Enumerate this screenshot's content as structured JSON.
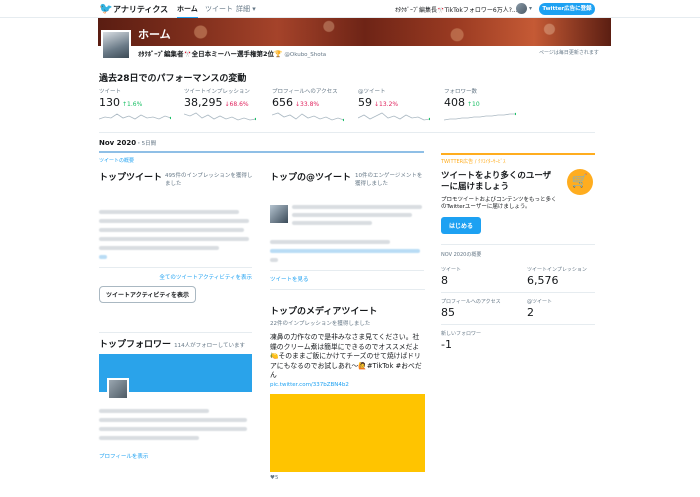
{
  "nav": {
    "brand": "アナリティクス",
    "tabs": [
      {
        "label": "ホーム",
        "active": true
      },
      {
        "label": "ツイート",
        "active": false
      },
      {
        "label": "詳細",
        "active": false
      }
    ],
    "account_label": "ｵﾀｸﾎﾞｰﾌﾞ編集長🎌TikTokフォロワー6万人?...",
    "ads_button": "Twitter広告に登録"
  },
  "banner": {
    "title": "ホーム"
  },
  "profile": {
    "name": "ｵﾀｸﾎﾞｰﾌﾞ編集者🎌全日本ミーハー選手権第2位🏆",
    "handle": "@Okubo_Shota"
  },
  "update_note": "ページは毎日更新されます",
  "performance": {
    "title": "過去28日でのパフォーマンスの変動",
    "metrics": [
      {
        "label": "ツイート",
        "value": "130",
        "change": "1.6%",
        "dir": "up"
      },
      {
        "label": "ツイートインプレッション",
        "value": "38,295",
        "change": "68.6%",
        "dir": "down"
      },
      {
        "label": "プロフィールへのアクセス",
        "value": "656",
        "change": "33.8%",
        "dir": "down"
      },
      {
        "label": "@ツイート",
        "value": "59",
        "change": "13.2%",
        "dir": "down"
      },
      {
        "label": "フォロワー数",
        "value": "408",
        "change": "10",
        "dir": "up"
      }
    ]
  },
  "period": {
    "label": "Nov 2020",
    "days": "・5日間"
  },
  "summary_label": "ツイートの概要",
  "top_tweet": {
    "title": "トップツイート",
    "sub": "495件のインプレッションを獲得しました",
    "all_link": "全てのツイートアクティビティを表示",
    "button": "ツイートアクティビティを表示"
  },
  "top_mention": {
    "title": "トップの@ツイート",
    "sub": "10件のエンゲージメントを獲得しました",
    "link": "ツイートを見る"
  },
  "top_media": {
    "title": "トップのメディアツイート",
    "sub": "22件のインプレッションを獲得しました",
    "text": "凍鼻の力作なので是非みなさま見てください。社蝶のクリーム煮は簡単にできるのでオススメだよ🍋そのままご飯にかけてチーズのせて焼けばドリアにもなるのでお試しあれ〜🙋#TikTok #おべだん",
    "pic_link": "pic.twitter.com/337bZBN4b2",
    "likes": "5"
  },
  "top_follower": {
    "title": "トップフォロワー",
    "sub": "114人がフォローしています",
    "link": "プロフィールを表示"
  },
  "promo": {
    "tag": "TWITTER広告 / ｸﾘｴｲﾀｰｻｰﾋﾞｽ",
    "title": "ツイートをより多くのユーザーに届けましょう",
    "text": "プロモツイートおよびコンテンツをもっと多くのTwitterユーザーに届けましょう。",
    "button": "はじめる"
  },
  "summary": {
    "title": "NOV 2020の概要",
    "stats": [
      {
        "label": "ツイート",
        "value": "8"
      },
      {
        "label": "ツイートインプレッション",
        "value": "6,576"
      },
      {
        "label": "プロフィールへのアクセス",
        "value": "85"
      },
      {
        "label": "@ツイート",
        "value": "2"
      },
      {
        "label": "新しいフォロワー",
        "value": "-1"
      }
    ]
  },
  "colors": {
    "accent": "#1da1f2",
    "up": "#17bf63",
    "down": "#e0245e",
    "promo": "#ffad1f",
    "media": "#ffc400"
  }
}
